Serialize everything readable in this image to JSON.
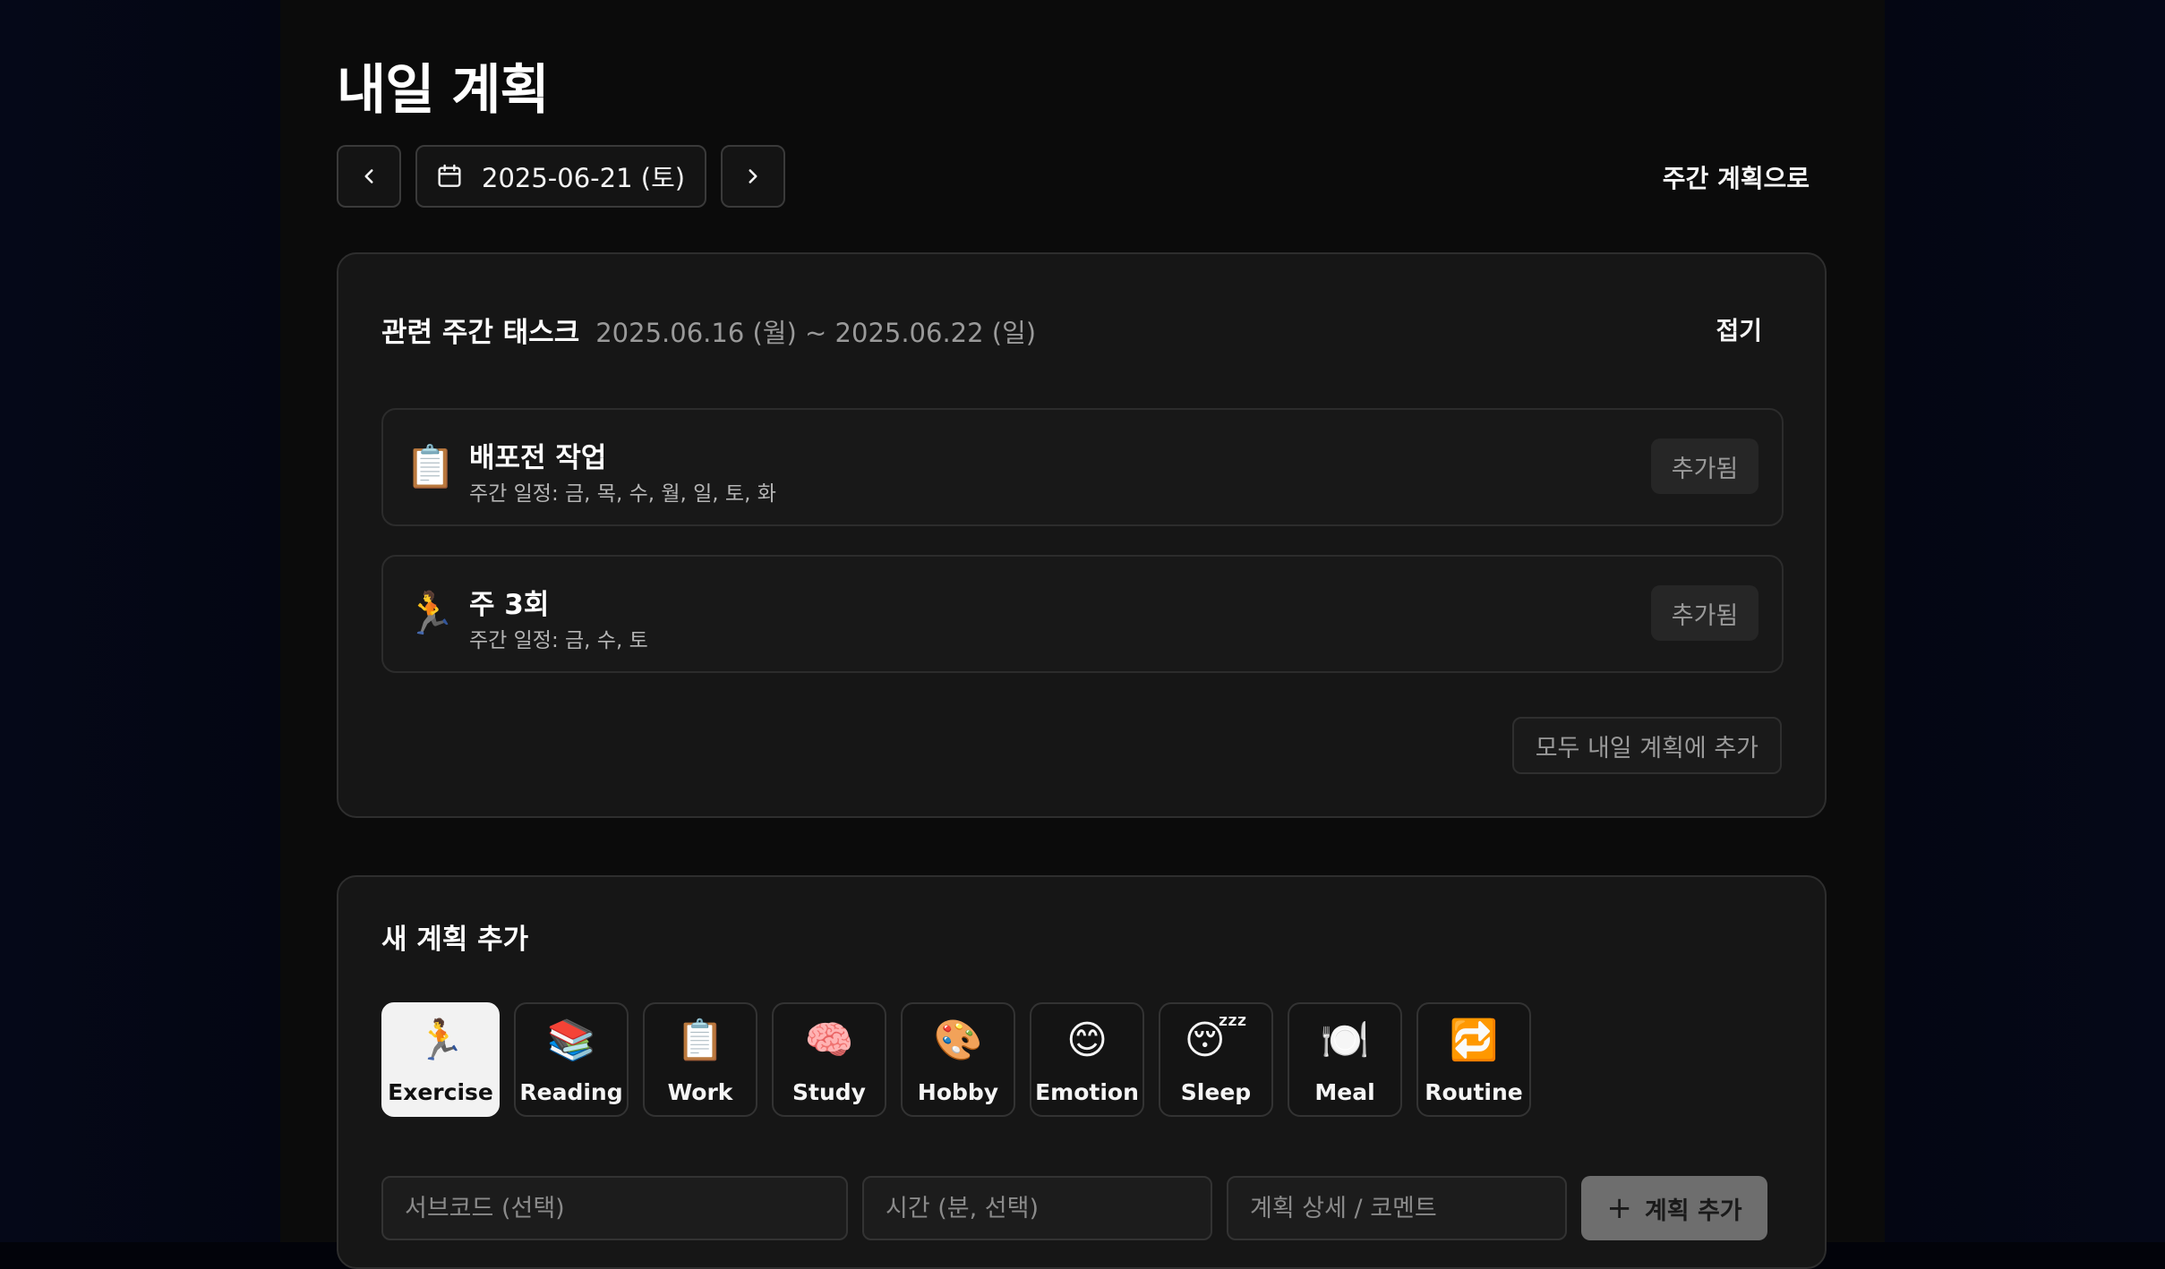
{
  "page": {
    "title": "내일 계획",
    "date": "2025-06-21 (토)",
    "week_link": "주간 계획으로"
  },
  "weekly": {
    "title": "관련 주간 태스크",
    "range": "2025.06.16 (월) ~ 2025.06.22 (일)",
    "fold_label": "접기",
    "tasks": [
      {
        "emoji": "📋",
        "name": "배포전 작업",
        "schedule": "주간 일정: 금, 목, 수, 월, 일, 토, 화",
        "status": "추가됨"
      },
      {
        "emoji": "🏃",
        "name": "주 3회",
        "schedule": "주간 일정: 금, 수, 토",
        "status": "추가됨"
      }
    ],
    "add_all_label": "모두 내일 계획에 추가"
  },
  "new_plan": {
    "title": "새 계획 추가",
    "categories": [
      {
        "emoji": "🏃",
        "label": "Exercise"
      },
      {
        "emoji": "📚",
        "label": "Reading"
      },
      {
        "emoji": "📋",
        "label": "Work"
      },
      {
        "emoji": "🧠",
        "label": "Study"
      },
      {
        "emoji": "🎨",
        "label": "Hobby"
      },
      {
        "emoji": "😊",
        "label": "Emotion"
      },
      {
        "emoji": "😴",
        "label": "Sleep"
      },
      {
        "emoji": "🍽️",
        "label": "Meal"
      },
      {
        "emoji": "🔁",
        "label": "Routine"
      }
    ],
    "selected_category": "Exercise",
    "subcode_placeholder": "서브코드 (선택)",
    "time_placeholder": "시간 (분, 선택)",
    "detail_placeholder": "계획 상세 / 코멘트",
    "add_button_label": "계획 추가"
  }
}
